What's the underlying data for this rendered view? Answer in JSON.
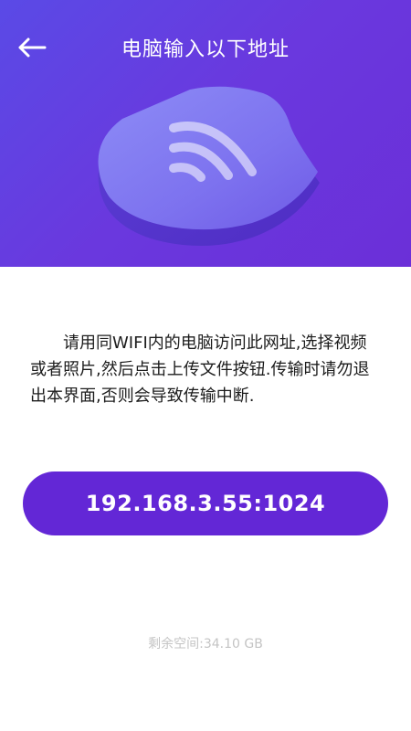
{
  "header": {
    "title": "电脑输入以下地址",
    "back_icon": "back-arrow-icon"
  },
  "hero": {
    "illustration": "wifi-shield-illustration",
    "gradient_start": "#5a4ae6",
    "gradient_end": "#6b2fd8"
  },
  "instructions": {
    "text": "请用同WIFI内的电脑访问此网址,选择视频或者照片,然后点击上传文件按钮.传输时请勿退出本界面,否则会导致传输中断."
  },
  "address": {
    "value": "192.168.3.55:1024",
    "button_color": "#6327d6"
  },
  "storage": {
    "text": "剩余空间:34.10 GB"
  }
}
